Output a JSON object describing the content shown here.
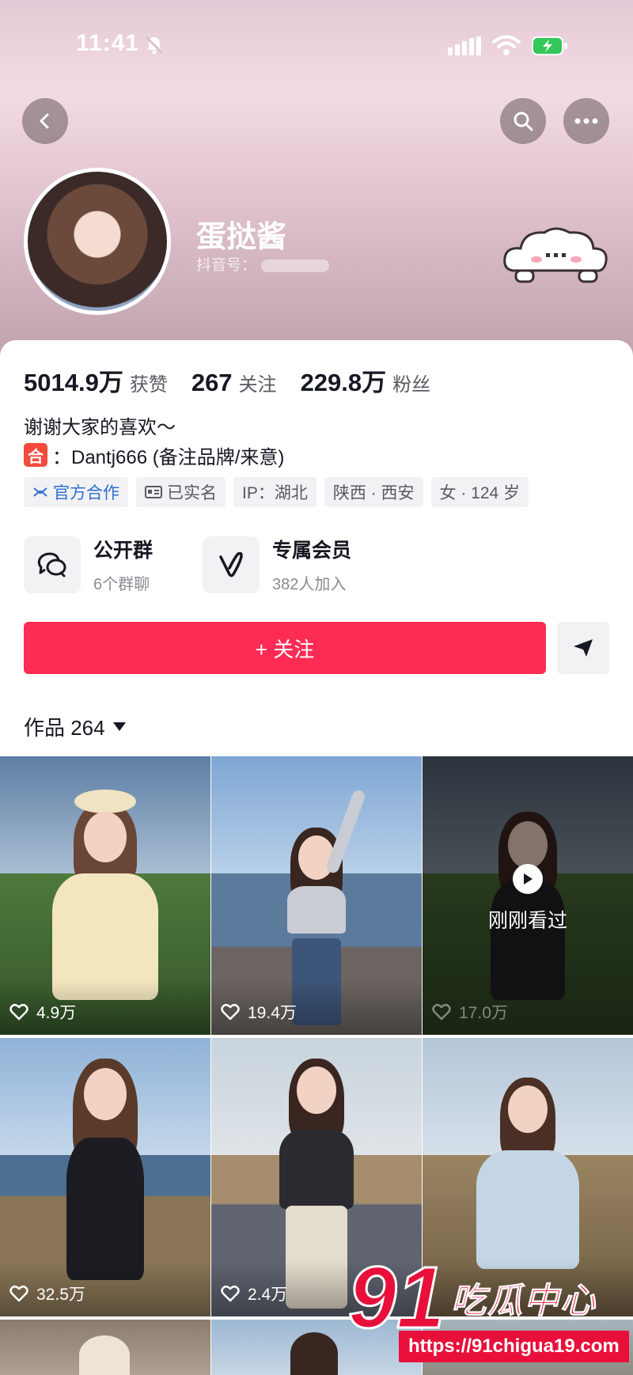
{
  "status_bar": {
    "time": "11:41"
  },
  "profile": {
    "name": "蛋挞酱",
    "douyin_id_label": "抖音号："
  },
  "stats": [
    {
      "value": "5014.9万",
      "label": "获赞"
    },
    {
      "value": "267",
      "label": "关注"
    },
    {
      "value": "229.8万",
      "label": "粉丝"
    }
  ],
  "bio": "谢谢大家的喜欢～",
  "business": {
    "badge": "合",
    "text": "：Dantj666 (备注品牌/来意)"
  },
  "tags": [
    "官方合作",
    "已实名",
    "IP：湖北",
    "陕西 · 西安",
    "女 · 124 岁"
  ],
  "features": [
    {
      "title": "公开群",
      "subtitle": "6个群聊",
      "icon": "chat-bubbles-icon"
    },
    {
      "title": "专属会员",
      "subtitle": "382人加入",
      "icon": "v-membership-icon"
    }
  ],
  "actions": {
    "follow_label": "+ 关注"
  },
  "works": {
    "label": "作品 264"
  },
  "videos": [
    {
      "likes": "4.9万"
    },
    {
      "likes": "19.4万"
    },
    {
      "likes": "17.0万",
      "overlay": "刚刚看过"
    },
    {
      "likes": "32.5万"
    },
    {
      "likes": "2.4万"
    },
    {
      "likes": ""
    }
  ],
  "watermark": {
    "number": "91",
    "name": "吃瓜中心",
    "url": "https://91chigua19.com"
  },
  "colors": {
    "accent": "#fe2c55",
    "official_tag": "#2e6fd1",
    "badge_red": "#f24a3c"
  }
}
